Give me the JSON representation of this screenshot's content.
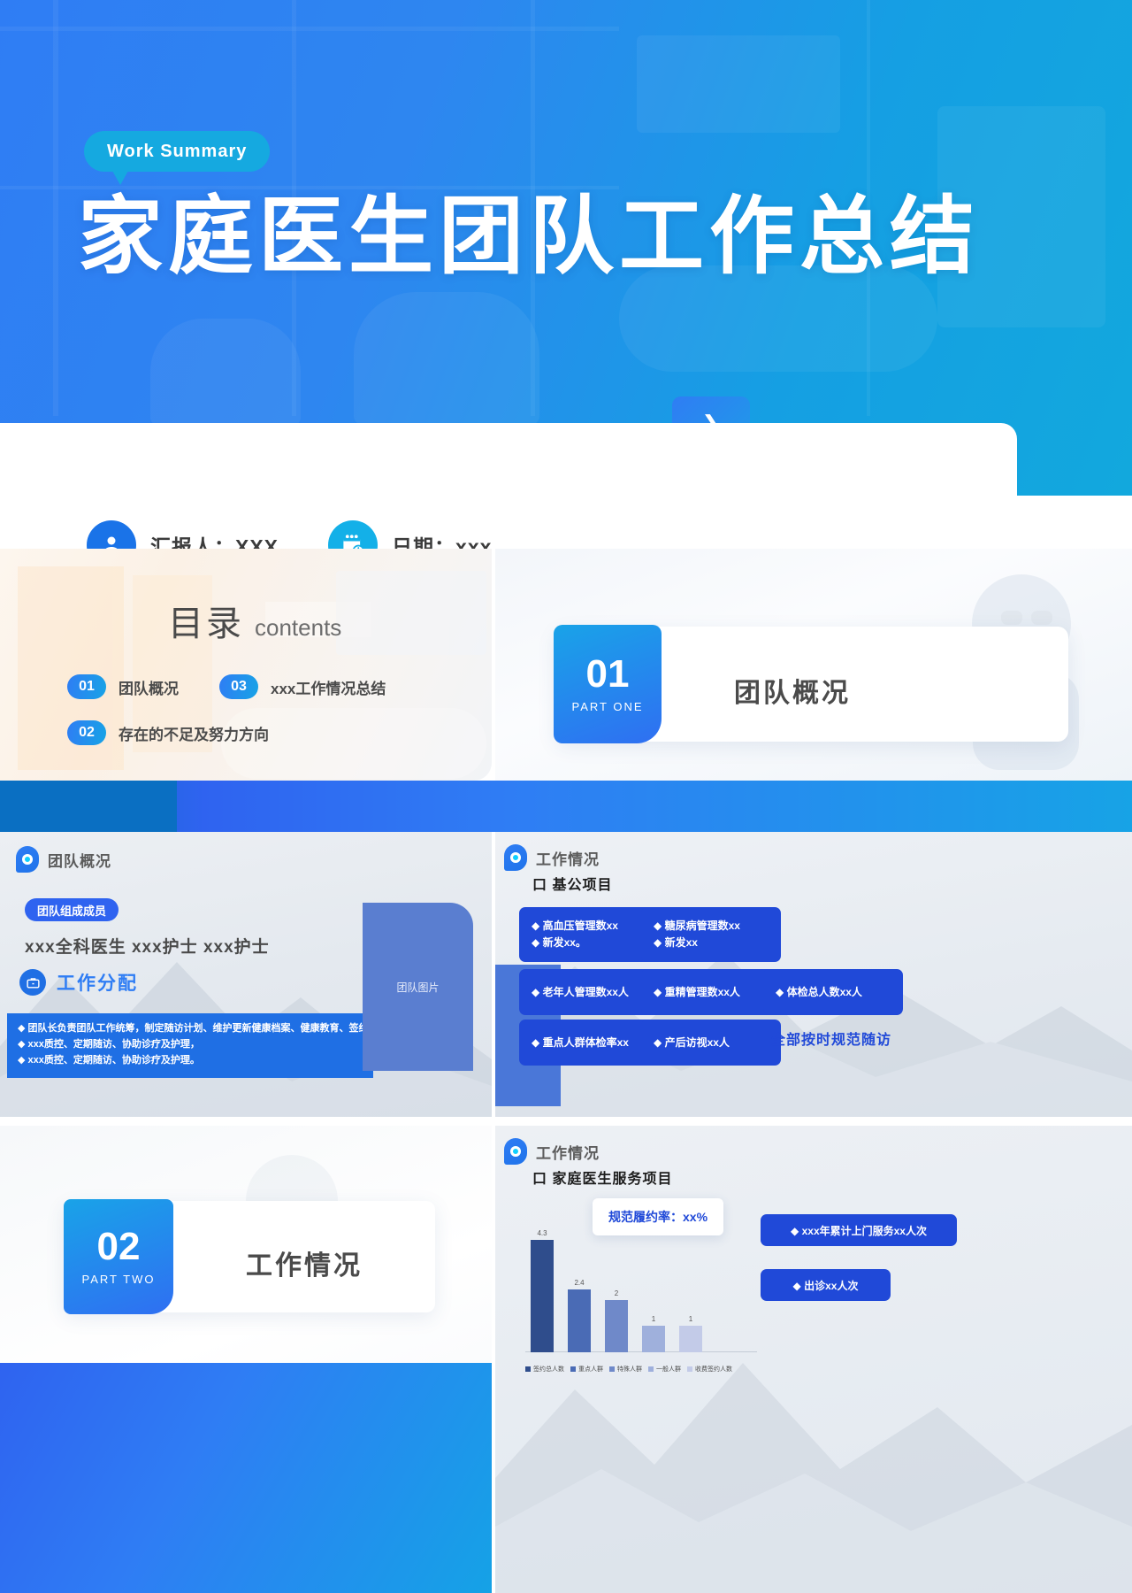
{
  "cover": {
    "badge": "Work  Summary",
    "title": "家庭医生团队工作总结",
    "arrow": "❯",
    "presenter": {
      "icon": "person-icon",
      "label": "汇报人：XXX"
    },
    "date": {
      "icon": "calendar-clock-icon",
      "label": "日期：xxx"
    }
  },
  "contents": {
    "title_cn": "目录",
    "title_en": "contents",
    "items": [
      {
        "num": "01",
        "label": "团队概况"
      },
      {
        "num": "03",
        "label": "xxx工作情况总结"
      },
      {
        "num": "02",
        "label": "存在的不足及努力方向"
      }
    ]
  },
  "part_one": {
    "num": "01",
    "sub": "PART ONE",
    "title": "团队概况"
  },
  "part_two": {
    "num": "02",
    "sub": "PART TWO",
    "title": "工作情况"
  },
  "team_slide": {
    "section": "团队概况",
    "members_badge": "团队组成成员",
    "members": "xxx全科医生  xxx护士  xxx护士",
    "alloc_title": "工作分配",
    "alloc_items": [
      "◆ 团队长负责团队工作统筹，制定随访计划、维护更新健康档案、健康教育、签约等。",
      "◆ xxx质控、定期随访、协助诊疗及护理，",
      "◆ xxx质控、定期随访、协助诊疗及护理。"
    ],
    "image_placeholder": "团队图片"
  },
  "work_slide": {
    "section": "工作情况",
    "subhead": "口 基公项目",
    "chips": [
      {
        "lines": [
          "◆ 高血压管理数xx",
          "◆ 新发xx。"
        ]
      },
      {
        "lines": [
          "◆ 糖尿病管理数xx",
          "◆ 新发xx"
        ]
      },
      {
        "lines": [
          "◆ 老年人管理数xx人"
        ]
      },
      {
        "lines": [
          "◆ 重精管理数xx人"
        ]
      },
      {
        "lines": [
          "◆ 体检总人数xx人"
        ]
      },
      {
        "lines": [
          "◆ 重点人群体检率xx"
        ]
      },
      {
        "lines": [
          "◆ 产后访视xx人"
        ]
      }
    ],
    "note": "全部按时规范随访"
  },
  "chart_slide": {
    "section": "工作情况",
    "subhead": "口 家庭医生服务项目",
    "callout": "规范履约率：xx%",
    "buttons": [
      "◆ xxx年累计上门服务xx人次",
      "◆ 出诊xx人次"
    ]
  },
  "chart_data": {
    "type": "bar",
    "title": "家庭医生服务项目",
    "categories": [
      "签约总人数",
      "重点人群",
      "特殊人群",
      "一般人群",
      "收费签约人数"
    ],
    "values": [
      4.3,
      2.4,
      2,
      1,
      1
    ],
    "labels": [
      "4.3",
      "2.4",
      "2",
      "1",
      "1"
    ],
    "colors": [
      "#2f4d8c",
      "#4a6bb5",
      "#6f89c9",
      "#9fb0dc",
      "#c3cbe8"
    ],
    "xlabel": "",
    "ylabel": "",
    "ylim": [
      0,
      5
    ],
    "grid": false,
    "legend_position": "bottom"
  },
  "colors": {
    "brand_blue": "#2f7df4",
    "cyan": "#15a9e0",
    "deep_blue": "#2049d8",
    "band": "#0a6fc2"
  }
}
